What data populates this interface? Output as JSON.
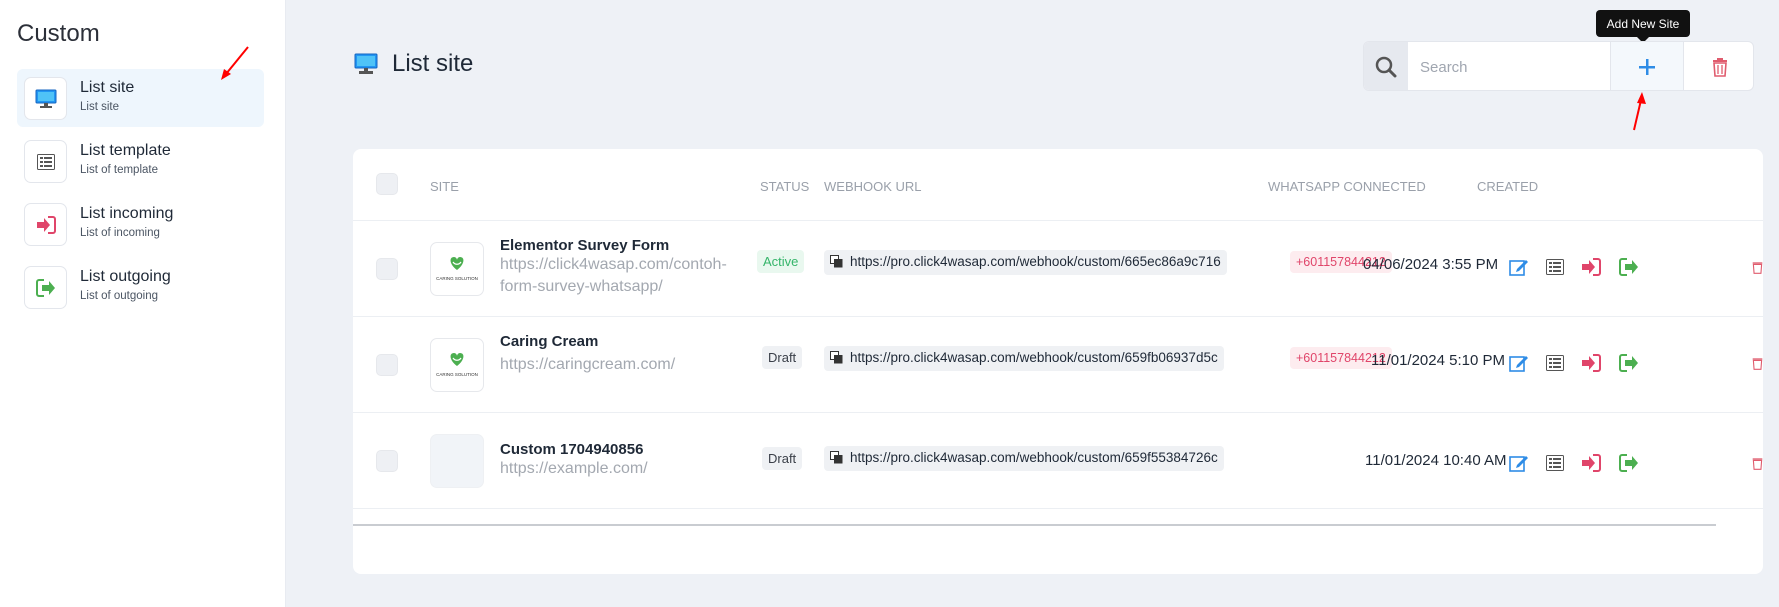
{
  "sidebar": {
    "title": "Custom",
    "items": [
      {
        "label": "List site",
        "sub": "List site",
        "icon": "monitor-icon"
      },
      {
        "label": "List template",
        "sub": "List of template",
        "icon": "list-icon"
      },
      {
        "label": "List incoming",
        "sub": "List of incoming",
        "icon": "sign-in-icon"
      },
      {
        "label": "List outgoing",
        "sub": "List of outgoing",
        "icon": "sign-out-icon"
      }
    ]
  },
  "header": {
    "title": "List site",
    "search_placeholder": "Search",
    "add_tooltip": "Add New Site"
  },
  "table": {
    "columns": {
      "site": "SITE",
      "status": "STATUS",
      "webhook": "WEBHOOK URL",
      "whatsapp": "WHATSAPP CONNECTED",
      "created": "CREATED"
    },
    "rows": [
      {
        "name": "Elementor Survey Form",
        "url": "https://click4wasap.com/contoh-form-survey-whatsapp/",
        "status": "Active",
        "webhook": "https://pro.click4wasap.com/webhook/custom/665ec86a9c716",
        "whatsapp": "+601157844212",
        "created": "04/06/2024 3:55 PM",
        "logo_text": "CARING SOLUTION"
      },
      {
        "name": "Caring Cream",
        "url": "https://caringcream.com/",
        "status": "Draft",
        "webhook": "https://pro.click4wasap.com/webhook/custom/659fb06937d5c",
        "whatsapp": "+601157844212",
        "created": "11/01/2024 5:10 PM",
        "logo_text": "CARING SOLUTION"
      },
      {
        "name": "Custom 1704940856",
        "url": "https://example.com/",
        "status": "Draft",
        "webhook": "https://pro.click4wasap.com/webhook/custom/659f55384726c",
        "whatsapp": "",
        "created": "11/01/2024 10:40 AM",
        "logo_text": ""
      }
    ]
  },
  "colors": {
    "accent": "#2e8ce6",
    "active_status": "#35b56a",
    "whatsapp_pink": "#e0456a",
    "delete_red": "#e05c6e",
    "annotation_red": "#ff0000"
  }
}
